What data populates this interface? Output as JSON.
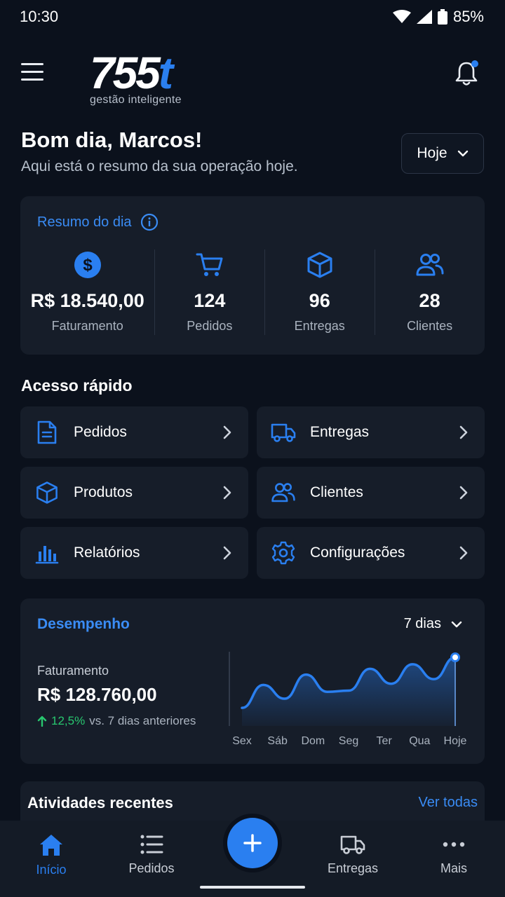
{
  "status_bar": {
    "time": "10:30",
    "battery": "85%"
  },
  "brand": {
    "name_main": "755",
    "name_accent": "t",
    "tagline": "gestão inteligente",
    "accent_color": "#2a7ff0"
  },
  "greeting": {
    "title": "Bom dia, Marcos!",
    "subtitle": "Aqui está o resumo da sua operação hoje."
  },
  "period_select": {
    "value": "Hoje"
  },
  "summary": {
    "title": "Resumo do dia",
    "items": [
      {
        "icon": "dollar-icon",
        "value": "R$ 18.540,00",
        "label": "Faturamento"
      },
      {
        "icon": "cart-icon",
        "value": "124",
        "label": "Pedidos"
      },
      {
        "icon": "box-icon",
        "value": "96",
        "label": "Entregas"
      },
      {
        "icon": "users-icon",
        "value": "28",
        "label": "Clientes"
      }
    ]
  },
  "quick_access": {
    "title": "Acesso rápido",
    "items": [
      {
        "icon": "document-icon",
        "label": "Pedidos"
      },
      {
        "icon": "truck-icon",
        "label": "Entregas"
      },
      {
        "icon": "box-icon",
        "label": "Produtos"
      },
      {
        "icon": "users-icon",
        "label": "Clientes"
      },
      {
        "icon": "chart-icon",
        "label": "Relatórios"
      },
      {
        "icon": "gear-icon",
        "label": "Configurações"
      }
    ]
  },
  "performance": {
    "title": "Desempenho",
    "period": "7 dias",
    "metric_label": "Faturamento",
    "metric_value": "R$ 128.760,00",
    "delta_value": "12,5%",
    "delta_text": "vs. 7 dias anteriores"
  },
  "chart_data": {
    "type": "area",
    "categories": [
      "Sex",
      "Sáb",
      "Dom",
      "Seg",
      "Ter",
      "Qua",
      "Hoje"
    ],
    "values": [
      12,
      52,
      28,
      70,
      40,
      42,
      80,
      54,
      88,
      62,
      100
    ],
    "note_points": [
      "Sex",
      "",
      "Sáb",
      "",
      "Dom",
      "",
      "Seg",
      "",
      "Ter",
      "Qua",
      "Hoje"
    ],
    "series": [
      {
        "values": [
          12,
          52,
          28,
          70,
          40,
          42,
          80,
          54,
          88,
          62,
          100
        ]
      }
    ],
    "color": "#2a7ff0"
  },
  "recent": {
    "title": "Atividades recentes",
    "link": "Ver todas"
  },
  "bottom_nav": {
    "items": [
      {
        "icon": "home-icon",
        "label": "Início",
        "active": true
      },
      {
        "icon": "list-icon",
        "label": "Pedidos"
      },
      {
        "icon": "plus-icon",
        "label": ""
      },
      {
        "icon": "truck-icon",
        "label": "Entregas"
      },
      {
        "icon": "more-icon",
        "label": "Mais"
      }
    ]
  }
}
